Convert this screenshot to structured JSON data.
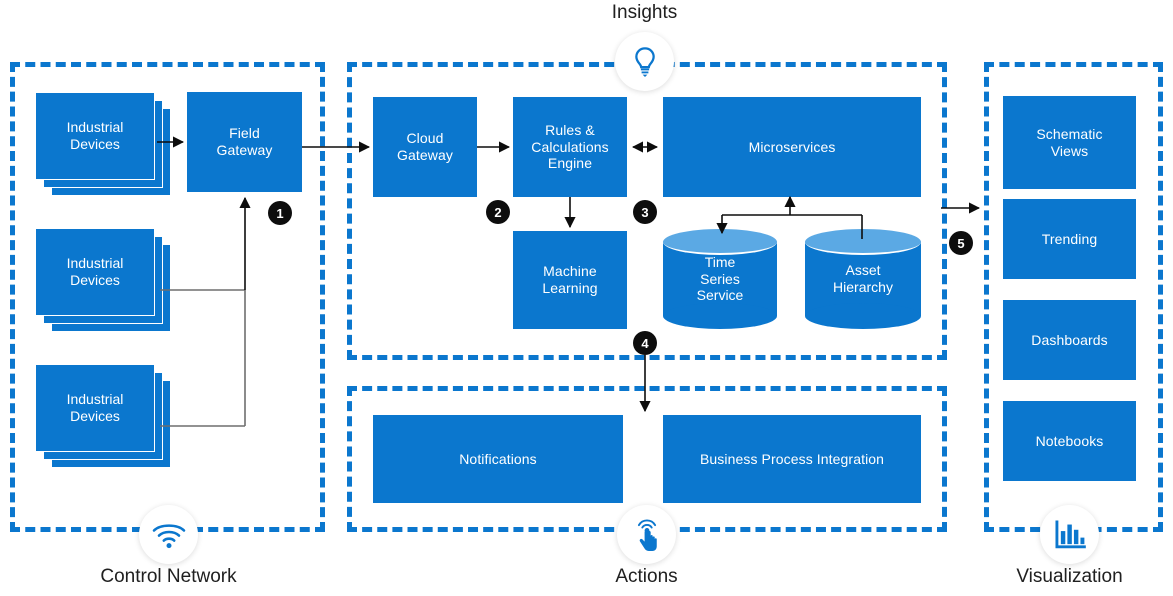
{
  "zones": {
    "control": {
      "caption": "Control Network",
      "icon": "wifi-icon"
    },
    "insights": {
      "caption": "Insights",
      "icon": "lightbulb-icon"
    },
    "actions": {
      "caption": "Actions",
      "icon": "touch-icon"
    },
    "visualization": {
      "caption": "Visualization",
      "icon": "bar-chart-icon"
    }
  },
  "control_network": {
    "devices": [
      {
        "label": "Industrial\nDevices"
      },
      {
        "label": "Industrial\nDevices"
      },
      {
        "label": "Industrial\nDevices"
      }
    ],
    "field_gateway": "Field\nGateway"
  },
  "insights": {
    "cloud_gateway": "Cloud\nGateway",
    "rules_engine": "Rules &\nCalculations\nEngine",
    "microservices": "Microservices",
    "machine_learning": "Machine\nLearning",
    "time_series": "Time\nSeries\nService",
    "asset_hierarchy": "Asset\nHierarchy"
  },
  "actions": {
    "notifications": "Notifications",
    "business_process": "Business Process Integration"
  },
  "visualization": {
    "items": [
      {
        "label": "Schematic\nViews"
      },
      {
        "label": "Trending"
      },
      {
        "label": "Dashboards"
      },
      {
        "label": "Notebooks"
      }
    ]
  },
  "step_badges": [
    {
      "number": "1"
    },
    {
      "number": "2"
    },
    {
      "number": "3"
    },
    {
      "number": "4"
    },
    {
      "number": "5"
    }
  ],
  "colors": {
    "primary_blue": "#0B77CE",
    "light_blue": "#5BA9E4",
    "badge_black": "#0d0d0d",
    "caption_text": "#202020",
    "connector_black": "#0d0d0d",
    "connector_gray": "#6e6e6e"
  }
}
